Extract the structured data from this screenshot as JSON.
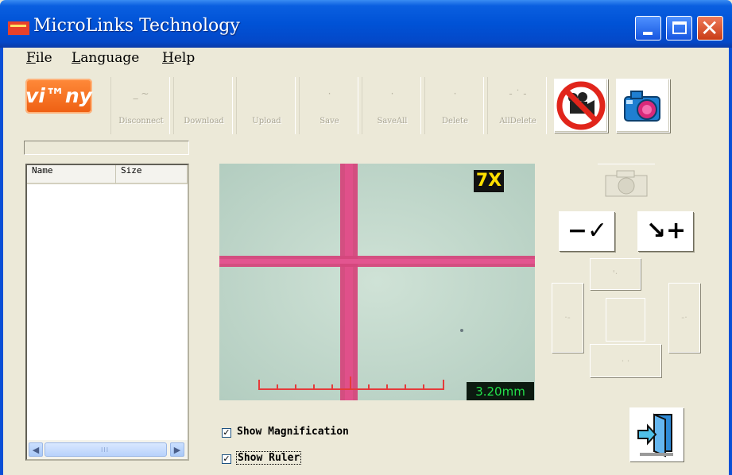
{
  "window": {
    "title": "MicroLinks Technology",
    "title_bar_color": "#0052d6"
  },
  "menu": [
    {
      "label_prefix": "",
      "underline": "F",
      "label_rest": "ile"
    },
    {
      "label_prefix": "",
      "underline": "L",
      "label_rest": "anguage"
    },
    {
      "label_prefix": "",
      "underline": "H",
      "label_rest": "elp"
    }
  ],
  "toolbar": {
    "logo_text": "vi™ny",
    "buttons": [
      {
        "label": "Disconnect",
        "icon": "disconnect-icon",
        "enabled": false
      },
      {
        "label": "Download",
        "icon": "download-icon",
        "enabled": false
      },
      {
        "label": "Upload",
        "icon": "upload-icon",
        "enabled": false
      },
      {
        "label": "Save",
        "icon": "save-icon",
        "enabled": false
      },
      {
        "label": "SaveAll",
        "icon": "save-all-icon",
        "enabled": false
      },
      {
        "label": "Delete",
        "icon": "delete-icon",
        "enabled": false
      },
      {
        "label": "AllDelete",
        "icon": "all-delete-icon",
        "enabled": false
      }
    ],
    "record_icon": "no-video-camera-icon",
    "capture_icon": "photo-camera-icon"
  },
  "file_list": {
    "columns": [
      "Name",
      "Size"
    ],
    "rows": [],
    "scroll_grip": "III"
  },
  "preview": {
    "magnification": "7X",
    "ruler_value": "3.20mm",
    "show_magnification": true,
    "show_ruler": true
  },
  "controls": {
    "zoom_out": "−✓",
    "zoom_in": "↘+",
    "exit_icon": "exit-door-icon"
  },
  "options": {
    "show_magnification_label": "Show Magnification",
    "show_ruler_label": "Show Ruler"
  }
}
